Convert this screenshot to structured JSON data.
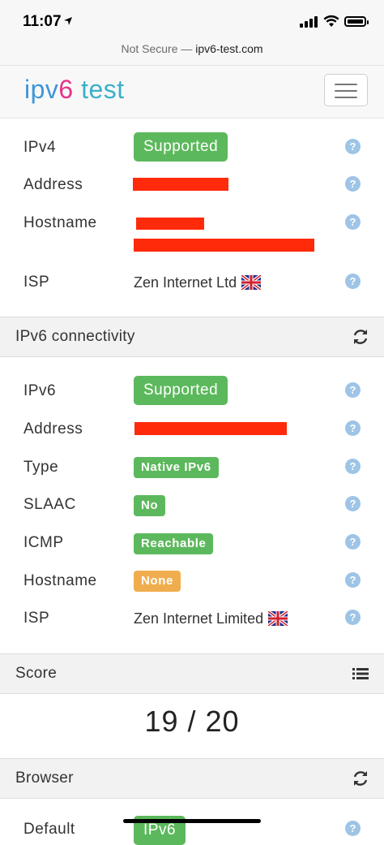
{
  "status_bar": {
    "time": "11:07"
  },
  "url_bar": {
    "security": "Not Secure",
    "separator": " — ",
    "host": "ipv6-test.com"
  },
  "logo": {
    "part1": "ipv",
    "part2": "6",
    "part3": " test"
  },
  "ipv4_section": {
    "rows": [
      {
        "label": "IPv4",
        "badge": "Supported"
      },
      {
        "label": "Address"
      },
      {
        "label": "Hostname"
      },
      {
        "label": "ISP",
        "value": "Zen Internet Ltd"
      }
    ]
  },
  "ipv6_section": {
    "title": "IPv6 connectivity",
    "rows": [
      {
        "label": "IPv6",
        "badge": "Supported"
      },
      {
        "label": "Address"
      },
      {
        "label": "Type",
        "badge": "Native IPv6"
      },
      {
        "label": "SLAAC",
        "badge": "No"
      },
      {
        "label": "ICMP",
        "badge": "Reachable"
      },
      {
        "label": "Hostname",
        "badge": "None"
      },
      {
        "label": "ISP",
        "value": "Zen Internet Limited"
      }
    ]
  },
  "score_section": {
    "title": "Score",
    "score": "19 / 20"
  },
  "browser_section": {
    "title": "Browser",
    "rows": [
      {
        "label": "Default",
        "badge": "IPv6"
      }
    ]
  },
  "help_symbol": "?",
  "colors": {
    "success": "#5cb85c",
    "warning": "#f0ad4e",
    "help": "#9ec4e6",
    "redaction": "#ff2a0a"
  },
  "icons": {
    "refresh": "refresh-icon",
    "list": "list-icon",
    "flag": "uk-flag-icon",
    "menu": "hamburger-icon"
  }
}
